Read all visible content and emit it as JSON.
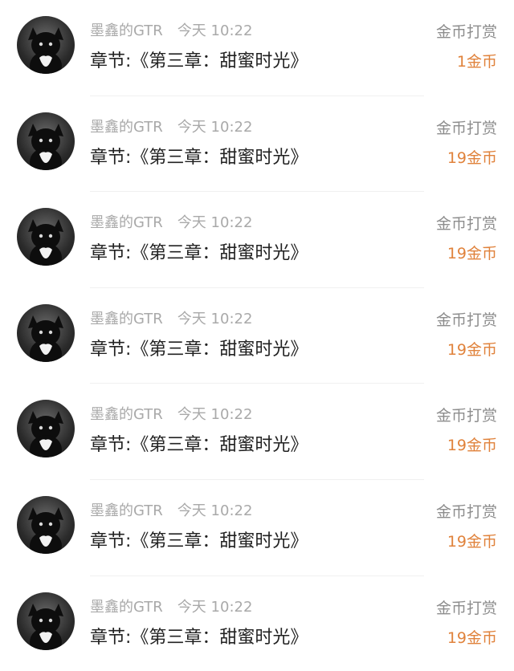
{
  "colors": {
    "name_time_text": "#a9a9a9",
    "chapter_text": "#222222",
    "type_text": "#8d8d8d",
    "amount_text": "#e0823b"
  },
  "rows": [
    {
      "user": "墨鑫的GTR",
      "time": "今天 10:22",
      "chapter": "章节:《第三章：甜蜜时光》",
      "type": "金币打赏",
      "amount": "1金币",
      "avatar_icon": "cat-avatar-icon"
    },
    {
      "user": "墨鑫的GTR",
      "time": "今天 10:22",
      "chapter": "章节:《第三章：甜蜜时光》",
      "type": "金币打赏",
      "amount": "19金币",
      "avatar_icon": "cat-avatar-icon"
    },
    {
      "user": "墨鑫的GTR",
      "time": "今天 10:22",
      "chapter": "章节:《第三章：甜蜜时光》",
      "type": "金币打赏",
      "amount": "19金币",
      "avatar_icon": "cat-avatar-icon"
    },
    {
      "user": "墨鑫的GTR",
      "time": "今天 10:22",
      "chapter": "章节:《第三章：甜蜜时光》",
      "type": "金币打赏",
      "amount": "19金币",
      "avatar_icon": "cat-avatar-icon"
    },
    {
      "user": "墨鑫的GTR",
      "time": "今天 10:22",
      "chapter": "章节:《第三章：甜蜜时光》",
      "type": "金币打赏",
      "amount": "19金币",
      "avatar_icon": "cat-avatar-icon"
    },
    {
      "user": "墨鑫的GTR",
      "time": "今天 10:22",
      "chapter": "章节:《第三章：甜蜜时光》",
      "type": "金币打赏",
      "amount": "19金币",
      "avatar_icon": "cat-avatar-icon"
    },
    {
      "user": "墨鑫的GTR",
      "time": "今天 10:22",
      "chapter": "章节:《第三章：甜蜜时光》",
      "type": "金币打赏",
      "amount": "19金币",
      "avatar_icon": "cat-avatar-icon"
    }
  ]
}
